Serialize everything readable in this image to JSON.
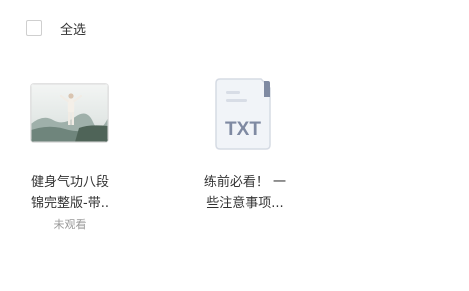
{
  "header": {
    "select_all_label": "全选"
  },
  "files": [
    {
      "type": "video",
      "name_line1": "健身气功八段",
      "name_line2": "锦完整版-带..",
      "status": "未观看"
    },
    {
      "type": "txt",
      "badge": "TXT",
      "name_line1": "练前必看！ 一",
      "name_line2": "些注意事项..."
    }
  ]
}
